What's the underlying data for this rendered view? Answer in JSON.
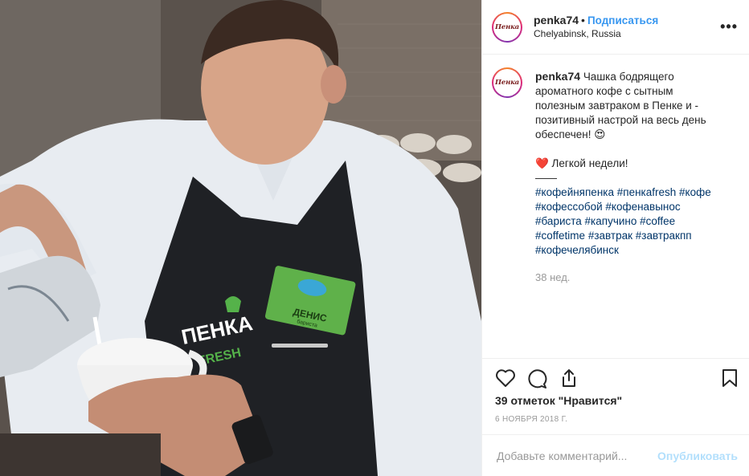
{
  "post": {
    "username": "penka74",
    "dot": "•",
    "follow_label": "Подписаться",
    "location": "Chelyabinsk, Russia",
    "avatar_text": "Пенка",
    "more_icon": "more-horizontal-icon",
    "caption": {
      "username": "penka74",
      "text": "Чашка бодрящего ароматного кофе с сытным полезным завтраком в Пенке и - позитивный настрой на весь день обеспечен! 😍",
      "line2": "❤️ Легкой недели!",
      "divider": "——",
      "hashtags": [
        "#кофейняпенка",
        "#пенкаfresh",
        "#кофе",
        "#кофессобой",
        "#кофенавынос",
        "#бариста",
        "#капучино",
        "#coffee",
        "#coffetime",
        "#завтрак",
        "#завтракпп",
        "#кофечелябинск"
      ],
      "time_ago": "38 нед."
    },
    "actions": {
      "like_icon": "heart-icon",
      "comment_icon": "comment-icon",
      "share_icon": "share-icon",
      "save_icon": "bookmark-icon"
    },
    "likes": "39 отметок \"Нравится\"",
    "date": "6 НОЯБРЯ 2018 Г.",
    "comment": {
      "placeholder": "Добавьте комментарий...",
      "publish_label": "Опубликовать"
    },
    "photo": {
      "apron_brand": "ПЕНКА",
      "apron_sub": "FRESH",
      "badge_name": "ДЕНИС",
      "badge_role": "бариста"
    },
    "colors": {
      "link_blue": "#3897f0",
      "hashtag": "#003569",
      "badge_green": "#5fb14a"
    }
  }
}
